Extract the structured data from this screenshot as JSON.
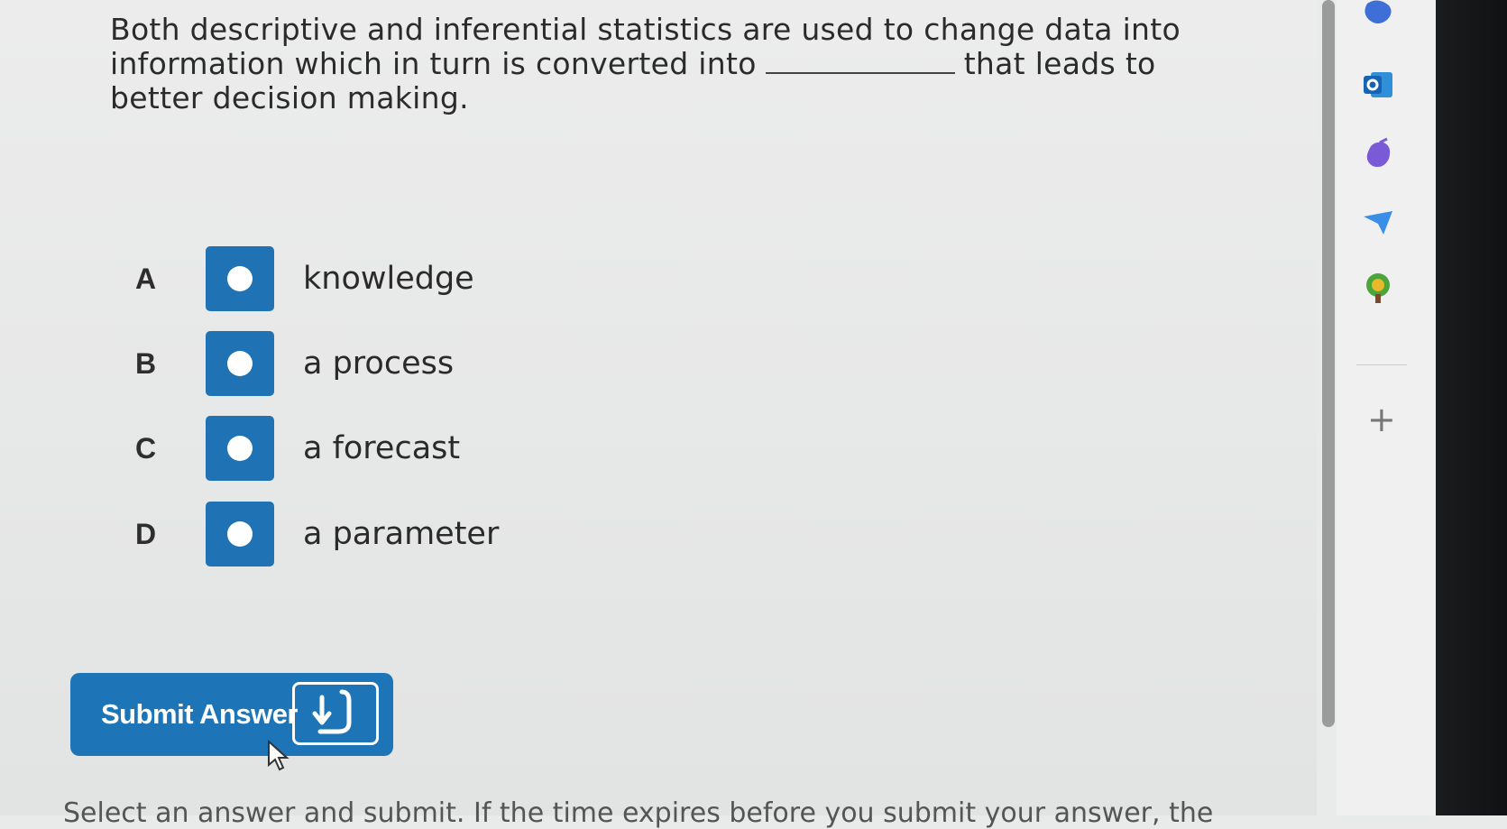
{
  "question": {
    "part1": "Both descriptive and inferential statistics are used to change data into information which in turn is converted into",
    "part2": "that leads to better decision making."
  },
  "options": [
    {
      "letter": "A",
      "text": "knowledge"
    },
    {
      "letter": "B",
      "text": "a process"
    },
    {
      "letter": "C",
      "text": "a forecast"
    },
    {
      "letter": "D",
      "text": "a parameter"
    }
  ],
  "submit": {
    "label": "Submit Answer"
  },
  "footer": {
    "text": "Select an answer and submit. If the time expires before you submit your answer, the"
  },
  "sidebar": {
    "icons": [
      "copilot-icon",
      "outlook-icon",
      "games-icon",
      "send-icon",
      "tree-icon"
    ],
    "add_label": "+"
  },
  "colors": {
    "accent": "#1f73b4",
    "background": "#e9eaea"
  }
}
